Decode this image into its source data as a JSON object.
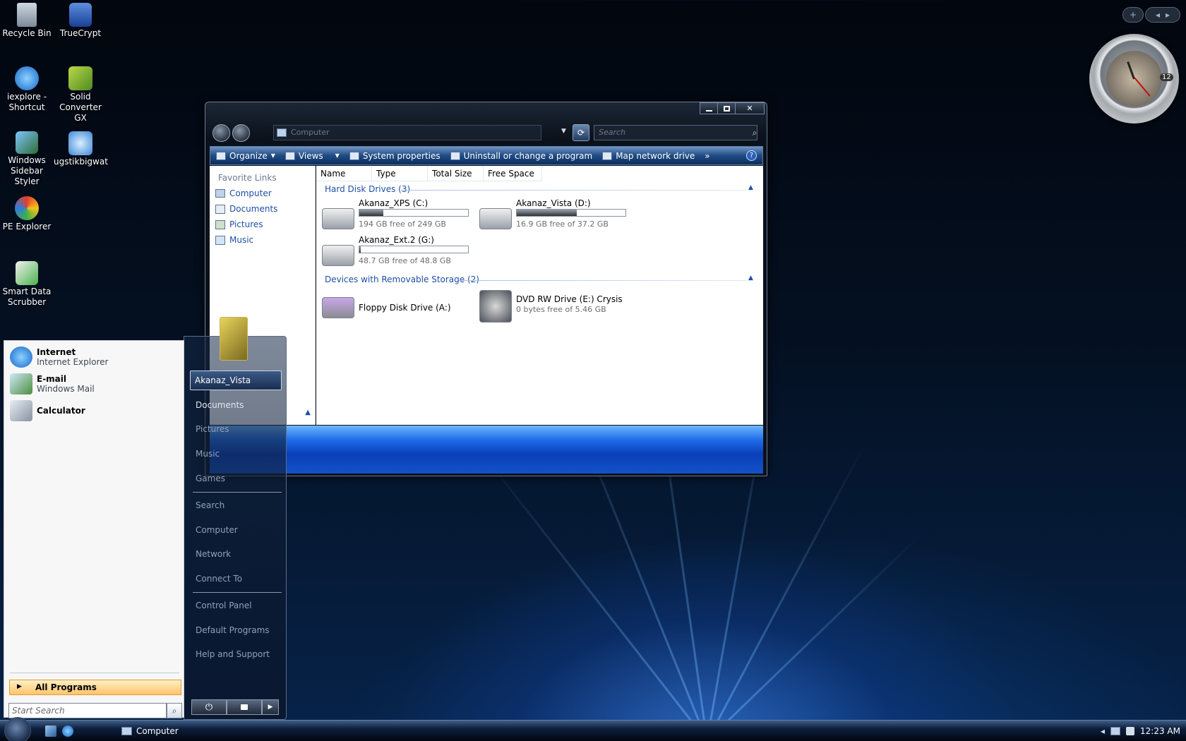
{
  "desktop": {
    "icons": [
      {
        "label": "Recycle Bin"
      },
      {
        "label": "TrueCrypt"
      },
      {
        "label": "iexplore - Shortcut"
      },
      {
        "label": "Solid Converter GX"
      },
      {
        "label": "Windows Sidebar Styler"
      },
      {
        "label": "ugstikbigwat"
      },
      {
        "label": "PE Explorer"
      },
      {
        "label": "Smart Data Scrubber"
      }
    ]
  },
  "explorer": {
    "address": "Computer",
    "search_placeholder": "Search",
    "toolbar": {
      "organize": "Organize",
      "views": "Views",
      "system_properties": "System properties",
      "uninstall": "Uninstall or change a program",
      "map_drive": "Map network drive",
      "more": "»",
      "help": "?"
    },
    "favorite_links": {
      "title": "Favorite Links",
      "items": [
        "Computer",
        "Documents",
        "Pictures",
        "Music"
      ]
    },
    "columns": [
      "Name",
      "Type",
      "Total Size",
      "Free Space"
    ],
    "groups": {
      "hard_disks": {
        "title": "Hard Disk Drives (3)",
        "drives": [
          {
            "name": "Akanaz_XPS (C:)",
            "free": "194 GB free of 249 GB",
            "used_fraction": 0.22
          },
          {
            "name": "Akanaz_Vista (D:)",
            "free": "16.9 GB free of 37.2 GB",
            "used_fraction": 0.55
          },
          {
            "name": "Akanaz_Ext.2 (G:)",
            "free": "48.7 GB free of 48.8 GB",
            "used_fraction": 0.01
          }
        ]
      },
      "removable": {
        "title": "Devices with Removable Storage (2)",
        "drives": [
          {
            "name": "Floppy Disk Drive (A:)"
          },
          {
            "name": "DVD RW Drive (E:) Crysis",
            "free": "0 bytes free of 5.46 GB"
          }
        ]
      }
    }
  },
  "start_menu": {
    "pinned": [
      {
        "title": "Internet",
        "subtitle": "Internet Explorer"
      },
      {
        "title": "E-mail",
        "subtitle": "Windows Mail"
      },
      {
        "title": "Calculator",
        "subtitle": ""
      }
    ],
    "all_programs": "All Programs",
    "search_placeholder": "Start Search",
    "right_links": {
      "user": "Akanaz_Vista",
      "documents": "Documents",
      "pictures": "Pictures",
      "music": "Music",
      "games": "Games",
      "search": "Search",
      "computer": "Computer",
      "network": "Network",
      "connect_to": "Connect To",
      "control_panel": "Control Panel",
      "default_programs": "Default Programs",
      "help": "Help and Support"
    }
  },
  "taskbar": {
    "active_task": "Computer",
    "clock": "12:23 AM"
  },
  "gadget": {
    "clock_marker": "12",
    "add": "+",
    "prev": "◂",
    "next": "▸"
  },
  "colors": {
    "accent": "#1e4fa7",
    "toolbar_blue": "#1f4b84",
    "all_programs": "#ffc46b"
  }
}
